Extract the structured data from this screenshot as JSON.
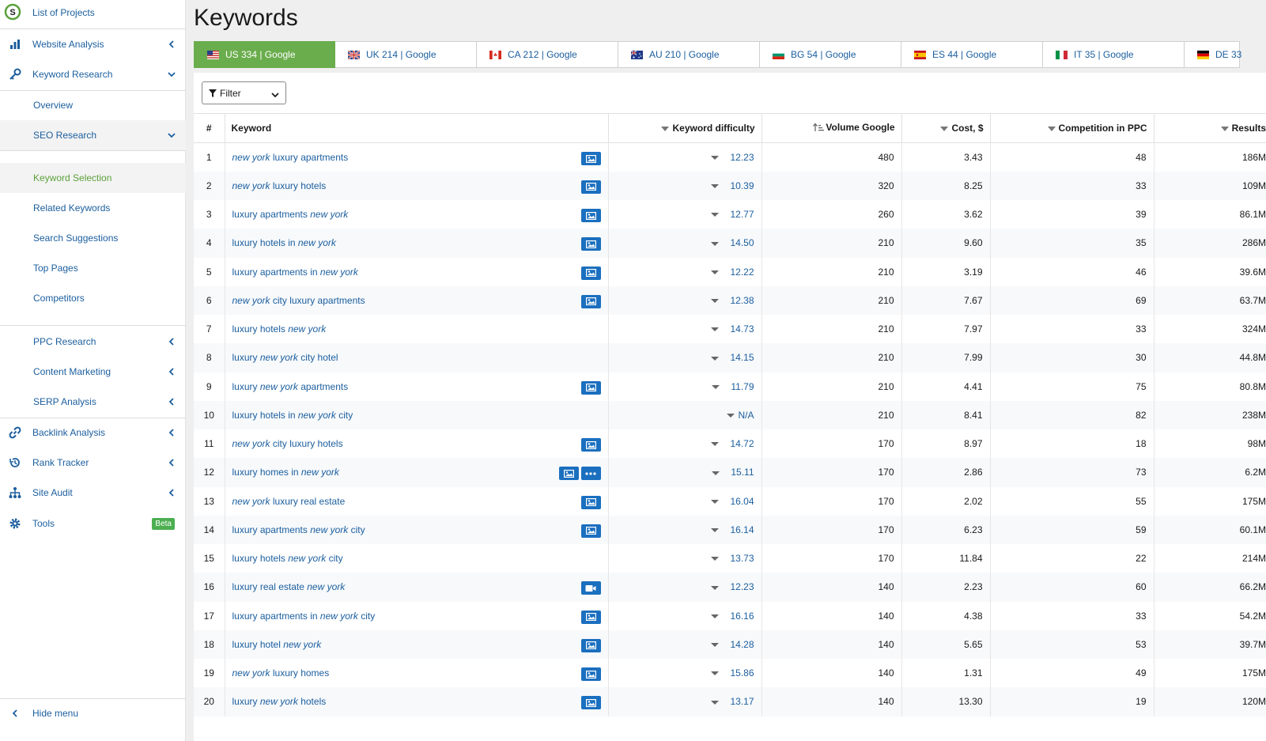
{
  "sidebar": {
    "items": [
      {
        "label": "List of Projects",
        "icon": "serpstat-logo-icon"
      },
      {
        "label": "Website Analysis",
        "icon": "chart-icon"
      },
      {
        "label": "Keyword Research",
        "icon": "key-icon"
      },
      {
        "label": "Overview"
      },
      {
        "label": "SEO Research"
      },
      {
        "label": "Keyword Selection"
      },
      {
        "label": "Related Keywords"
      },
      {
        "label": "Search Suggestions"
      },
      {
        "label": "Top Pages"
      },
      {
        "label": "Competitors"
      },
      {
        "label": "PPC Research"
      },
      {
        "label": "Content Marketing"
      },
      {
        "label": "SERP Analysis"
      },
      {
        "label": "Backlink Analysis",
        "icon": "link-icon"
      },
      {
        "label": "Rank Tracker",
        "icon": "history-icon"
      },
      {
        "label": "Site Audit",
        "icon": "sitemap-icon"
      },
      {
        "label": "Tools",
        "icon": "gear-icon",
        "badge": "Beta"
      },
      {
        "label": "Hide menu"
      }
    ]
  },
  "main": {
    "title": "Keywords",
    "tabs": [
      {
        "label": "US 334 | Google",
        "flag": "us"
      },
      {
        "label": "UK 214 | Google",
        "flag": "uk"
      },
      {
        "label": "CA 212 | Google",
        "flag": "ca"
      },
      {
        "label": "AU 210 | Google",
        "flag": "au"
      },
      {
        "label": "BG 54 | Google",
        "flag": "bg"
      },
      {
        "label": "ES 44 | Google",
        "flag": "es"
      },
      {
        "label": "IT 35 | Google",
        "flag": "it"
      },
      {
        "label": "DE 33",
        "flag": "de"
      }
    ],
    "filter_label": "Filter",
    "columns": [
      "#",
      "Keyword",
      "Keyword difficulty",
      "Volume Google",
      "Cost, $",
      "Competition in PPC",
      "Results"
    ],
    "rows": [
      {
        "n": "1",
        "kw": [
          [
            "i",
            "new york"
          ],
          [
            "t",
            " luxury apartments"
          ]
        ],
        "feat": [
          "image"
        ],
        "kd": "12.23",
        "vol": "480",
        "cost": "3.43",
        "comp": "48",
        "res": "186M"
      },
      {
        "n": "2",
        "kw": [
          [
            "i",
            "new york"
          ],
          [
            "t",
            " luxury hotels"
          ]
        ],
        "feat": [
          "image"
        ],
        "kd": "10.39",
        "vol": "320",
        "cost": "8.25",
        "comp": "33",
        "res": "109M"
      },
      {
        "n": "3",
        "kw": [
          [
            "t",
            "luxury apartments "
          ],
          [
            "i",
            "new york"
          ]
        ],
        "feat": [
          "image"
        ],
        "kd": "12.77",
        "vol": "260",
        "cost": "3.62",
        "comp": "39",
        "res": "86.1M"
      },
      {
        "n": "4",
        "kw": [
          [
            "t",
            "luxury hotels in "
          ],
          [
            "i",
            "new york"
          ]
        ],
        "feat": [
          "image"
        ],
        "kd": "14.50",
        "vol": "210",
        "cost": "9.60",
        "comp": "35",
        "res": "286M"
      },
      {
        "n": "5",
        "kw": [
          [
            "t",
            "luxury apartments in "
          ],
          [
            "i",
            "new york"
          ]
        ],
        "feat": [
          "image"
        ],
        "kd": "12.22",
        "vol": "210",
        "cost": "3.19",
        "comp": "46",
        "res": "39.6M"
      },
      {
        "n": "6",
        "kw": [
          [
            "i",
            "new york"
          ],
          [
            "t",
            " city luxury apartments"
          ]
        ],
        "feat": [
          "image"
        ],
        "kd": "12.38",
        "vol": "210",
        "cost": "7.67",
        "comp": "69",
        "res": "63.7M"
      },
      {
        "n": "7",
        "kw": [
          [
            "t",
            "luxury hotels "
          ],
          [
            "i",
            "new york"
          ]
        ],
        "feat": [],
        "kd": "14.73",
        "vol": "210",
        "cost": "7.97",
        "comp": "33",
        "res": "324M"
      },
      {
        "n": "8",
        "kw": [
          [
            "t",
            "luxury "
          ],
          [
            "i",
            "new york"
          ],
          [
            "t",
            " city hotel"
          ]
        ],
        "feat": [],
        "kd": "14.15",
        "vol": "210",
        "cost": "7.99",
        "comp": "30",
        "res": "44.8M"
      },
      {
        "n": "9",
        "kw": [
          [
            "t",
            "luxury "
          ],
          [
            "i",
            "new york"
          ],
          [
            "t",
            " apartments"
          ]
        ],
        "feat": [
          "image"
        ],
        "kd": "11.79",
        "vol": "210",
        "cost": "4.41",
        "comp": "75",
        "res": "80.8M"
      },
      {
        "n": "10",
        "kw": [
          [
            "t",
            "luxury hotels in "
          ],
          [
            "i",
            "new york"
          ],
          [
            "t",
            " city"
          ]
        ],
        "feat": [],
        "kd": "N/A",
        "vol": "210",
        "cost": "8.41",
        "comp": "82",
        "res": "238M"
      },
      {
        "n": "11",
        "kw": [
          [
            "i",
            "new york"
          ],
          [
            "t",
            " city luxury hotels"
          ]
        ],
        "feat": [
          "image"
        ],
        "kd": "14.72",
        "vol": "170",
        "cost": "8.97",
        "comp": "18",
        "res": "98M"
      },
      {
        "n": "12",
        "kw": [
          [
            "t",
            "luxury homes in "
          ],
          [
            "i",
            "new york"
          ]
        ],
        "feat": [
          "image",
          "more"
        ],
        "kd": "15.11",
        "vol": "170",
        "cost": "2.86",
        "comp": "73",
        "res": "6.2M"
      },
      {
        "n": "13",
        "kw": [
          [
            "i",
            "new york"
          ],
          [
            "t",
            " luxury real estate"
          ]
        ],
        "feat": [
          "image"
        ],
        "kd": "16.04",
        "vol": "170",
        "cost": "2.02",
        "comp": "55",
        "res": "175M"
      },
      {
        "n": "14",
        "kw": [
          [
            "t",
            "luxury apartments "
          ],
          [
            "i",
            "new york"
          ],
          [
            "t",
            " city"
          ]
        ],
        "feat": [
          "image"
        ],
        "kd": "16.14",
        "vol": "170",
        "cost": "6.23",
        "comp": "59",
        "res": "60.1M"
      },
      {
        "n": "15",
        "kw": [
          [
            "t",
            "luxury hotels "
          ],
          [
            "i",
            "new york"
          ],
          [
            "t",
            " city"
          ]
        ],
        "feat": [],
        "kd": "13.73",
        "vol": "170",
        "cost": "11.84",
        "comp": "22",
        "res": "214M"
      },
      {
        "n": "16",
        "kw": [
          [
            "t",
            "luxury real estate "
          ],
          [
            "i",
            "new york"
          ]
        ],
        "feat": [
          "video"
        ],
        "kd": "12.23",
        "vol": "140",
        "cost": "2.23",
        "comp": "60",
        "res": "66.2M"
      },
      {
        "n": "17",
        "kw": [
          [
            "t",
            "luxury apartments in "
          ],
          [
            "i",
            "new york"
          ],
          [
            "t",
            " city"
          ]
        ],
        "feat": [
          "image"
        ],
        "kd": "16.16",
        "vol": "140",
        "cost": "4.38",
        "comp": "33",
        "res": "54.2M"
      },
      {
        "n": "18",
        "kw": [
          [
            "t",
            "luxury hotel "
          ],
          [
            "i",
            "new york"
          ]
        ],
        "feat": [
          "image"
        ],
        "kd": "14.28",
        "vol": "140",
        "cost": "5.65",
        "comp": "53",
        "res": "39.7M"
      },
      {
        "n": "19",
        "kw": [
          [
            "i",
            "new york"
          ],
          [
            "t",
            " luxury homes"
          ]
        ],
        "feat": [
          "image"
        ],
        "kd": "15.86",
        "vol": "140",
        "cost": "1.31",
        "comp": "49",
        "res": "175M"
      },
      {
        "n": "20",
        "kw": [
          [
            "t",
            "luxury "
          ],
          [
            "i",
            "new york"
          ],
          [
            "t",
            " hotels"
          ]
        ],
        "feat": [
          "image"
        ],
        "kd": "13.17",
        "vol": "140",
        "cost": "13.30",
        "comp": "19",
        "res": "120M"
      }
    ]
  },
  "colors": {
    "accent": "#6aad4d",
    "link": "#1b5e9e",
    "badge": "#1b6fbf"
  }
}
